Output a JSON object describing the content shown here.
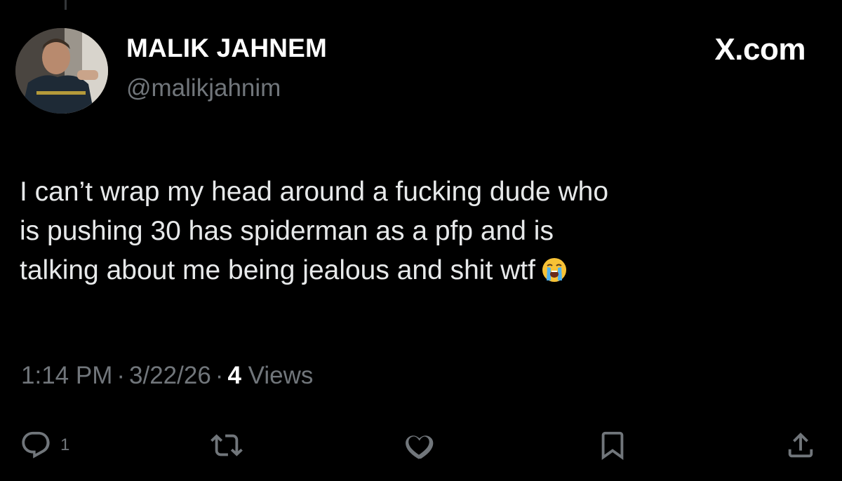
{
  "author": {
    "display_name": "MALIK JAHNEM",
    "handle": "@malikjahnim"
  },
  "source_label": "X.com",
  "tweet": {
    "lines": [
      "I can’t wrap my head around a fucking dude who",
      "is pushing 30 has spiderman as a pfp and is",
      "talking about me being jealous and shit wtf"
    ],
    "emoji": "loudly-crying-face"
  },
  "meta": {
    "time": "1:14 PM",
    "separator": "·",
    "date": "3/22/26",
    "views_count": "4",
    "views_label": "Views"
  },
  "actions": {
    "reply_count": "1",
    "icons": [
      "reply-icon",
      "retweet-icon",
      "like-icon",
      "bookmark-icon",
      "share-icon"
    ]
  },
  "colors": {
    "background": "#000000",
    "text_primary": "#e7e9ea",
    "text_secondary": "#71767b"
  }
}
